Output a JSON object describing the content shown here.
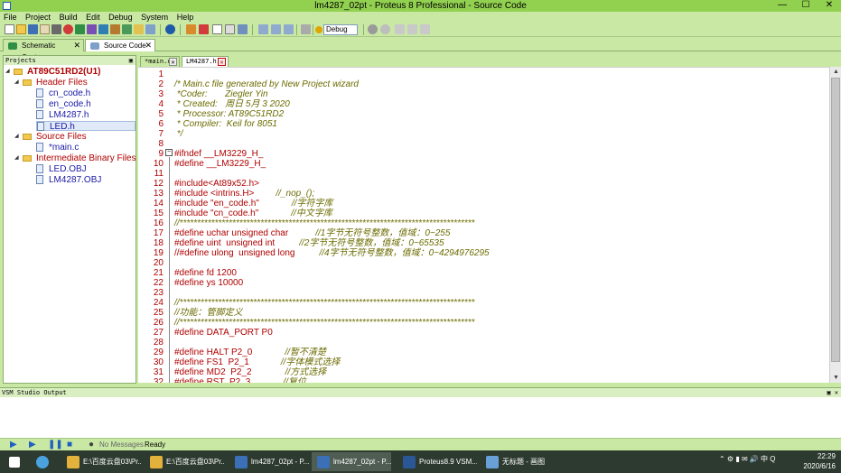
{
  "window": {
    "title": "lm4287_02pt - Proteus 8 Professional - Source Code",
    "minimize": "—",
    "maximize": "☐",
    "close": "✕"
  },
  "menu": [
    "File",
    "Project",
    "Build",
    "Edit",
    "Debug",
    "System",
    "Help"
  ],
  "toolbar": {
    "build_config": "Debug"
  },
  "top_tabs": [
    {
      "label": "Schematic Capture",
      "close": "✕"
    },
    {
      "label": "Source Code",
      "close": "✕"
    }
  ],
  "projects": {
    "header": "Projects",
    "pin": "▣",
    "root": "AT89C51RD2(U1)",
    "groups": [
      {
        "label": "Header Files",
        "files": [
          "cn_code.h",
          "en_code.h",
          "LM4287.h",
          "LED.h"
        ]
      },
      {
        "label": "Source Files",
        "files": [
          "*main.c"
        ]
      },
      {
        "label": "Intermediate Binary Files",
        "files": [
          "LED.OBJ",
          "LM4287.OBJ"
        ]
      }
    ]
  },
  "editor_tabs": [
    {
      "label": "*main.c",
      "close": "✕"
    },
    {
      "label": "LM4287.h",
      "close": "✕"
    }
  ],
  "code_lines": [
    {
      "n": "1",
      "text": "",
      "kind": "code"
    },
    {
      "n": "2",
      "text": "/* Main.c file generated by New Project wizard",
      "kind": "cm"
    },
    {
      "n": "3",
      "text": " *Coder:       Ziegler Yin",
      "kind": "cm"
    },
    {
      "n": "4",
      "text": " * Created:   周日 5月 3 2020",
      "kind": "cm"
    },
    {
      "n": "5",
      "text": " * Processor: AT89C51RD2",
      "kind": "cm"
    },
    {
      "n": "6",
      "text": " * Compiler:  Keil for 8051",
      "kind": "cm"
    },
    {
      "n": "7",
      "text": " */",
      "kind": "cm"
    },
    {
      "n": "8",
      "text": "",
      "kind": "code"
    },
    {
      "n": "9",
      "text": "#ifndef __LM3229_H_",
      "kind": "code"
    },
    {
      "n": "10",
      "text": "#define __LM3229_H_",
      "kind": "code"
    },
    {
      "n": "11",
      "text": "",
      "kind": "code"
    },
    {
      "n": "12",
      "text": "#include<At89x52.h>",
      "kind": "code"
    },
    {
      "n": "13",
      "text": "#include <intrins.H>",
      "kind": "code",
      "comment": "//_nop_();",
      "cpad": 24
    },
    {
      "n": "14",
      "text": "#include \"en_code.h\"",
      "kind": "code",
      "comment": "//字符字库",
      "cpad": 36
    },
    {
      "n": "15",
      "text": "#include \"cn_code.h\"",
      "kind": "code",
      "comment": "//中文字库",
      "cpad": 36
    },
    {
      "n": "16",
      "text": "//************************************************************************************",
      "kind": "cm"
    },
    {
      "n": "17",
      "text": "#define uchar unsigned char",
      "kind": "code",
      "comment": "//1字节无符号整数，值域：0~255",
      "cpad": 30
    },
    {
      "n": "18",
      "text": "#define uint  unsigned int",
      "kind": "code",
      "comment": "//2字节无符号整数，值域：0~65535",
      "cpad": 27
    },
    {
      "n": "19",
      "text": "//#define ulong  unsigned long",
      "kind": "code",
      "comment": "//4字节无符号整数，值域：0~4294976295",
      "cpad": 27
    },
    {
      "n": "20",
      "text": "",
      "kind": "code"
    },
    {
      "n": "21",
      "text": "#define fd 1200",
      "kind": "code"
    },
    {
      "n": "22",
      "text": "#define ys 10000",
      "kind": "code"
    },
    {
      "n": "23",
      "text": "",
      "kind": "code"
    },
    {
      "n": "24",
      "text": "//************************************************************************************",
      "kind": "cm"
    },
    {
      "n": "25",
      "text": "//功能：管脚定义",
      "kind": "cm"
    },
    {
      "n": "26",
      "text": "//************************************************************************************",
      "kind": "cm"
    },
    {
      "n": "27",
      "text": "#define DATA_PORT P0",
      "kind": "code"
    },
    {
      "n": "28",
      "text": "",
      "kind": "code"
    },
    {
      "n": "29",
      "text": "#define HALT P2_0",
      "kind": "code",
      "comment": "//暂不清楚",
      "cpad": 36
    },
    {
      "n": "30",
      "text": "#define FS1  P2_1",
      "kind": "code",
      "comment": "//字体模式选择",
      "cpad": 35
    },
    {
      "n": "31",
      "text": "#define MD2  P2_2",
      "kind": "code",
      "comment": "//方式选择",
      "cpad": 37
    },
    {
      "n": "32",
      "text": "#define RST  P2_3",
      "kind": "code",
      "comment": "//复位",
      "cpad": 36
    }
  ],
  "output": {
    "header": "VSM Studio Output",
    "pin": "▣ ✕"
  },
  "status": {
    "messages": "No Messages",
    "state": "Ready"
  },
  "taskbar": {
    "items": [
      {
        "label": "E:\\百度云盘03\\Pr...",
        "color": "#e3b23c"
      },
      {
        "label": "E:\\百度云盘03\\Pr...",
        "color": "#e3b23c"
      },
      {
        "label": "lm4287_02pt - P...",
        "color": "#3b6fb6"
      },
      {
        "label": "lm4287_02pt - P...",
        "color": "#3b6fb6"
      },
      {
        "label": "Proteus8.9 VSM...",
        "color": "#2b5797"
      },
      {
        "label": "无标题 - 画图",
        "color": "#6aa0d8"
      }
    ],
    "time": "22:29",
    "date": "2020/6/16"
  }
}
